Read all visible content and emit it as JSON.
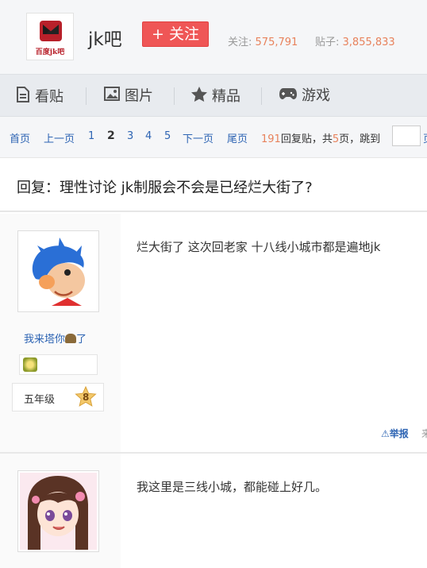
{
  "forum": {
    "logo_text": "百度jk吧",
    "name": "jk吧",
    "follow_label": "+ 关注",
    "followers_label": "关注:",
    "followers_value": "575,791",
    "posts_label": "贴子:",
    "posts_value": "3,855,833"
  },
  "nav": {
    "items": [
      {
        "label": "看贴",
        "icon": "document-icon"
      },
      {
        "label": "图片",
        "icon": "image-icon"
      },
      {
        "label": "精品",
        "icon": "star-icon"
      },
      {
        "label": "游戏",
        "icon": "gamepad-icon"
      }
    ]
  },
  "pager": {
    "first": "首页",
    "prev": "上一页",
    "pages": [
      "1",
      "2",
      "3",
      "4",
      "5"
    ],
    "current": "2",
    "next": "下一页",
    "last": "尾页",
    "reply_count": "191",
    "reply_label": "回复贴，共",
    "page_count": "5",
    "page_suffix": "页，跳到",
    "jump_edge": "页"
  },
  "thread": {
    "title": "回复：理性讨论 jk制服会不会是已经烂大街了?"
  },
  "posts": [
    {
      "username": "我来塔你",
      "username_suffix": "了",
      "level_name": "五年级",
      "level_num": "8",
      "content": "烂大街了 这次回老家 十八线小城市都是遍地jk",
      "report_label": "举报",
      "report_edge": "来"
    },
    {
      "content": "我这里是三线小城，都能碰上好几。"
    }
  ],
  "colors": {
    "follow_button": "#ef5656",
    "link_blue": "#2d64b3",
    "stat_orange": "#e8825c"
  }
}
